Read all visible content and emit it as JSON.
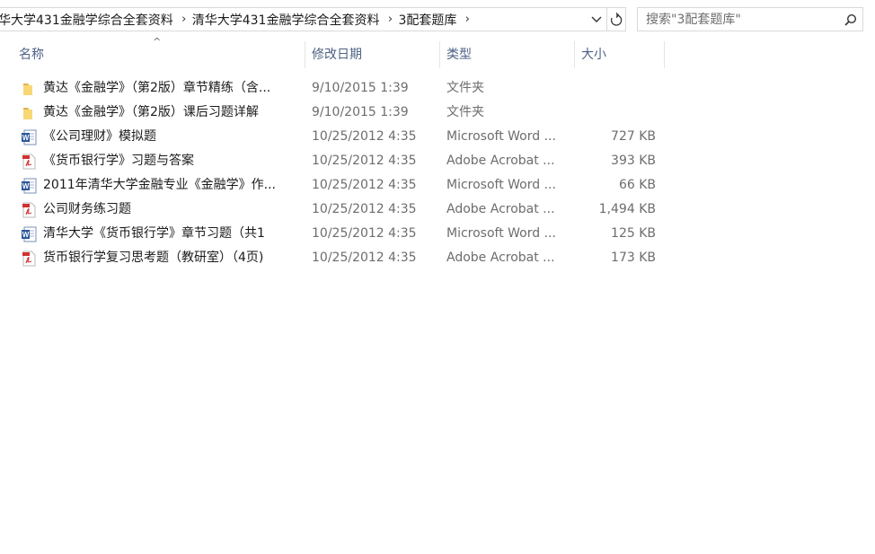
{
  "address": {
    "crumbs": [
      "华大学431金融学综合全套资料",
      "清华大学431金融学综合全套资料",
      "3配套题库"
    ],
    "separator": "›"
  },
  "search": {
    "placeholder": "搜索\"3配套题库\""
  },
  "columns": {
    "name": "名称",
    "date": "修改日期",
    "type": "类型",
    "size": "大小"
  },
  "files": [
    {
      "icon": "folder-icon",
      "name": "黄达《金融学》（第2版）章节精练（含...",
      "date": "9/10/2015 1:39",
      "type": "文件夹",
      "size": ""
    },
    {
      "icon": "folder-icon",
      "name": "黄达《金融学》（第2版）课后习题详解",
      "date": "9/10/2015 1:39",
      "type": "文件夹",
      "size": ""
    },
    {
      "icon": "word-icon",
      "name": "《公司理财》模拟题",
      "date": "10/25/2012 4:35",
      "type": "Microsoft Word ...",
      "size": "727 KB"
    },
    {
      "icon": "pdf-icon",
      "name": "《货币银行学》习题与答案",
      "date": "10/25/2012 4:35",
      "type": "Adobe Acrobat ...",
      "size": "393 KB"
    },
    {
      "icon": "word-icon",
      "name": "2011年清华大学金融专业《金融学》作...",
      "date": "10/25/2012 4:35",
      "type": "Microsoft Word ...",
      "size": "66 KB"
    },
    {
      "icon": "pdf-icon",
      "name": "公司财务练习题",
      "date": "10/25/2012 4:35",
      "type": "Adobe Acrobat ...",
      "size": "1,494 KB"
    },
    {
      "icon": "word-icon",
      "name": "清华大学《货币银行学》章节习题（共1",
      "date": "10/25/2012 4:35",
      "type": "Microsoft Word ...",
      "size": "125 KB"
    },
    {
      "icon": "pdf-icon",
      "name": "货币银行学复习思考题（教研室）（4页)",
      "date": "10/25/2012 4:35",
      "type": "Adobe Acrobat ...",
      "size": "173 KB"
    }
  ]
}
